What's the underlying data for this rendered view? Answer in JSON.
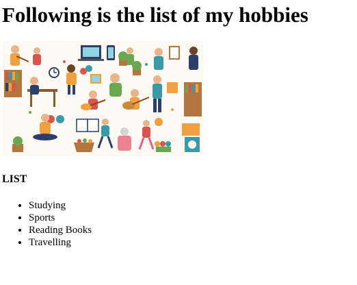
{
  "page": {
    "title": "Following is the list of my hobbies",
    "image": {
      "icon": "hobbies-illustration",
      "colors": {
        "background": "#fdfaf4",
        "orange": "#f0a040",
        "teal": "#3a9aa8",
        "navy": "#2c3e6b",
        "green": "#6aa84f",
        "red": "#d9534f",
        "skin": "#e8b48a"
      }
    },
    "list_heading": "LIST",
    "hobbies": [
      {
        "label": "Studying"
      },
      {
        "label": "Sports"
      },
      {
        "label": "Reading Books"
      },
      {
        "label": "Travelling"
      }
    ]
  }
}
